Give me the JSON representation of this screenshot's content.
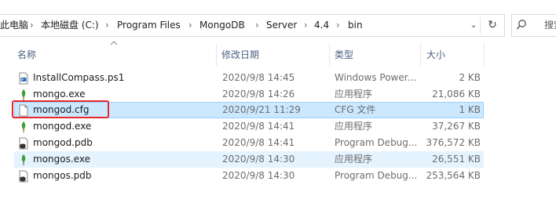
{
  "address": {
    "crumbs": [
      "此电脑",
      "本地磁盘 (C:)",
      "Program Files",
      "MongoDB",
      "Server",
      "4.4",
      "bin"
    ],
    "dropdown_glyph": "⌄",
    "refresh_glyph": "↻"
  },
  "search": {
    "placeholder": "搜索"
  },
  "columns": {
    "name": "名称",
    "modified": "修改日期",
    "type": "类型",
    "size": "大小"
  },
  "files": [
    {
      "name": "InstallCompass.ps1",
      "modified": "2020/9/8 14:45",
      "type": "Windows Power...",
      "size": "2 KB",
      "icon": "powershell-script-icon"
    },
    {
      "name": "mongo.exe",
      "modified": "2020/9/8 14:26",
      "type": "应用程序",
      "size": "21,086 KB",
      "icon": "mongodb-leaf-icon"
    },
    {
      "name": "mongod.cfg",
      "modified": "2020/9/21 11:29",
      "type": "CFG 文件",
      "size": "1 KB",
      "icon": "blank-file-icon"
    },
    {
      "name": "mongod.exe",
      "modified": "2020/9/8 14:41",
      "type": "应用程序",
      "size": "37,267 KB",
      "icon": "mongodb-leaf-icon"
    },
    {
      "name": "mongod.pdb",
      "modified": "2020/9/8 14:41",
      "type": "Program Debug...",
      "size": "376,572 KB",
      "icon": "debug-database-icon"
    },
    {
      "name": "mongos.exe",
      "modified": "2020/9/8 14:30",
      "type": "应用程序",
      "size": "26,551 KB",
      "icon": "mongodb-leaf-icon"
    },
    {
      "name": "mongos.pdb",
      "modified": "2020/9/8 14:30",
      "type": "Program Debug...",
      "size": "253,564 KB",
      "icon": "debug-database-icon"
    }
  ],
  "colors": {
    "selected_bg": "#cce8ff",
    "hover_bg": "#e5f3ff",
    "highlight_border": "#e8262c",
    "header_text": "#4d6082"
  }
}
